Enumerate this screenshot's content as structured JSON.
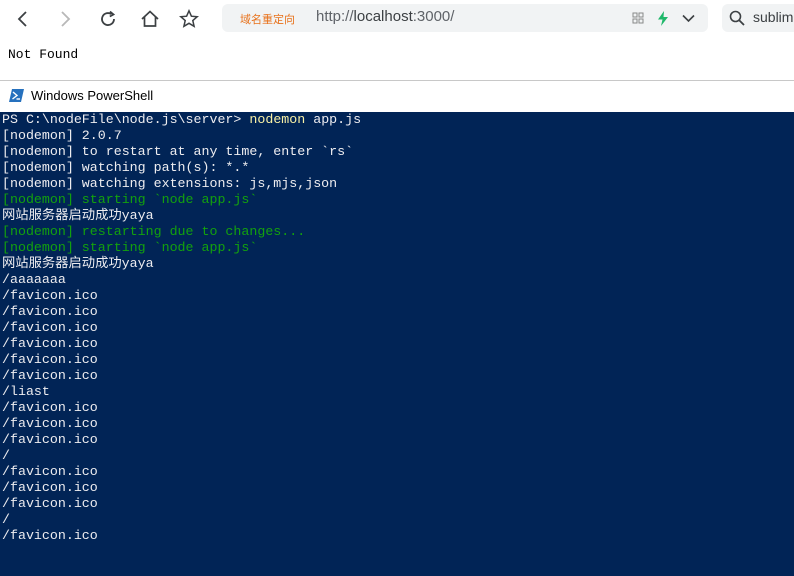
{
  "browser": {
    "redirect_label": "域名重定向",
    "url_protocol": "http://",
    "url_host": "localhost",
    "url_rest": ":3000/",
    "search_text": "sublime"
  },
  "page": {
    "body_text": "Not Found"
  },
  "powershell": {
    "title": "Windows PowerShell",
    "prompt": "PS C:\\nodeFile\\node.js\\server> ",
    "command": "nodemon",
    "args": " app.js",
    "lines": [
      {
        "text": "[nodemon] 2.0.7",
        "color": "white"
      },
      {
        "text": "[nodemon] to restart at any time, enter `rs`",
        "color": "white"
      },
      {
        "text": "[nodemon] watching path(s): *.*",
        "color": "white"
      },
      {
        "text": "[nodemon] watching extensions: js,mjs,json",
        "color": "white"
      },
      {
        "text": "[nodemon] starting `node app.js`",
        "color": "green"
      },
      {
        "text": "网站服务器启动成功yaya",
        "color": "white"
      },
      {
        "text": "[nodemon] restarting due to changes...",
        "color": "green"
      },
      {
        "text": "[nodemon] starting `node app.js`",
        "color": "green"
      },
      {
        "text": "网站服务器启动成功yaya",
        "color": "white"
      },
      {
        "text": "/aaaaaaa",
        "color": "white"
      },
      {
        "text": "/favicon.ico",
        "color": "white"
      },
      {
        "text": "/favicon.ico",
        "color": "white"
      },
      {
        "text": "/favicon.ico",
        "color": "white"
      },
      {
        "text": "/favicon.ico",
        "color": "white"
      },
      {
        "text": "/favicon.ico",
        "color": "white"
      },
      {
        "text": "/favicon.ico",
        "color": "white"
      },
      {
        "text": "/liast",
        "color": "white"
      },
      {
        "text": "/favicon.ico",
        "color": "white"
      },
      {
        "text": "/favicon.ico",
        "color": "white"
      },
      {
        "text": "/favicon.ico",
        "color": "white"
      },
      {
        "text": "/",
        "color": "white"
      },
      {
        "text": "/favicon.ico",
        "color": "white"
      },
      {
        "text": "/favicon.ico",
        "color": "white"
      },
      {
        "text": "/favicon.ico",
        "color": "white"
      },
      {
        "text": "/",
        "color": "white"
      },
      {
        "text": "/favicon.ico",
        "color": "white"
      }
    ]
  },
  "colors": {
    "console_bg": "#012456",
    "console_text": "#eeedf0",
    "console_green": "#13a10e",
    "console_command": "#f9f1a5",
    "redirect_orange": "#e8711a"
  },
  "icons": {
    "back": "arrow-left-icon",
    "forward": "arrow-right-icon",
    "reload": "reload-icon",
    "home": "home-icon",
    "favorite": "star-icon",
    "grid": "grid-icon",
    "lightning": "lightning-icon",
    "dropdown": "chevron-down-icon",
    "search": "search-icon",
    "powershell": "powershell-icon"
  }
}
